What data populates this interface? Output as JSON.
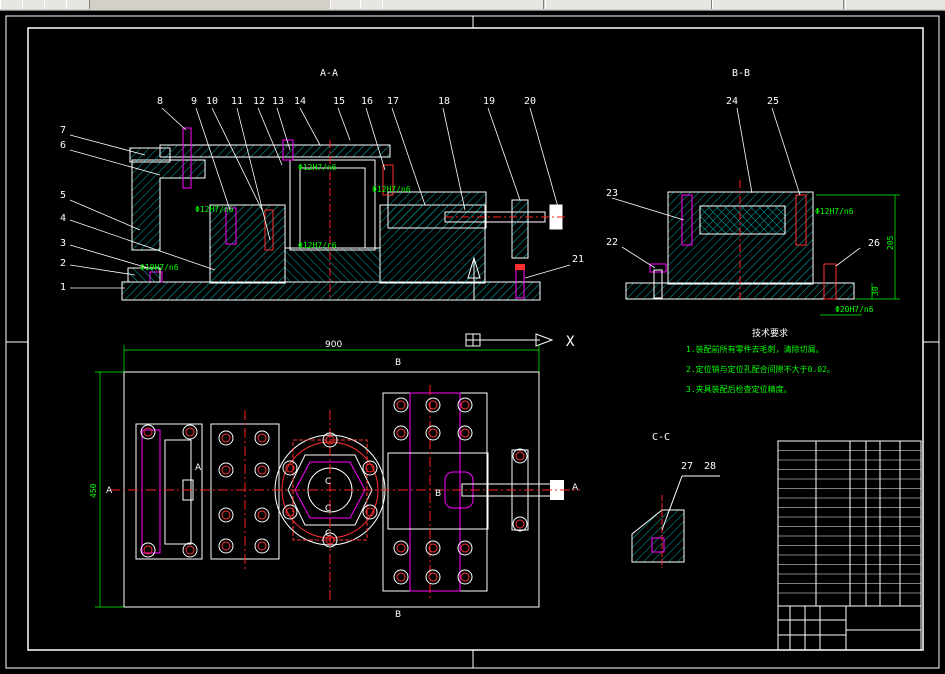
{
  "views": {
    "section_aa": "A-A",
    "section_bb": "B-B",
    "section_cc": "C-C"
  },
  "part_numbers_aa": [
    "1",
    "2",
    "3",
    "4",
    "5",
    "6",
    "7",
    "8",
    "9",
    "10",
    "11",
    "12",
    "13",
    "14",
    "15",
    "16",
    "17",
    "18",
    "19",
    "20",
    "21"
  ],
  "part_numbers_bb": [
    "22",
    "23",
    "24",
    "25",
    "26"
  ],
  "part_numbers_cc": [
    "27",
    "28"
  ],
  "dimensions": {
    "width": "900",
    "height": "450",
    "bb_height": "205",
    "bb_base": "30",
    "fit_a": "Φ12H7/n6",
    "fit_b": "Φ10H7/n6",
    "fit_c": "Φ12H7/r6",
    "fit_d": "Φ20H7/n6"
  },
  "section_marks": {
    "a_left": "A",
    "a_right": "A",
    "b_top": "B",
    "b_bottom": "B",
    "b_mid": "B",
    "c_top": "C",
    "c_mid": "C",
    "c_bottom": "C"
  },
  "axis": {
    "x_label": "X"
  },
  "tech_requirements": {
    "title": "技术要求",
    "lines": [
      "1.装配前所有零件去毛刺，清除切屑。",
      "2.定位销与定位孔配合间隙不大于0.02。",
      "3.夹具装配后检查定位精度。"
    ]
  },
  "colors": {
    "background": "#000000",
    "outline": "#ffffff",
    "hatch": "#00b3b3",
    "center_line": "#ff2020",
    "dimension": "#00ff00",
    "hidden": "#ff00ff",
    "bolt": "#ff3030",
    "yellow": "#ffff00"
  }
}
